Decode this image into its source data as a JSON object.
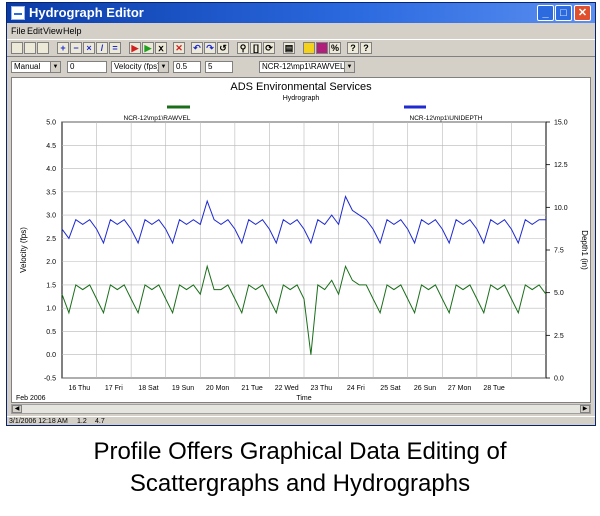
{
  "window": {
    "title": "Hydrograph Editor",
    "controls": {
      "minimize": "_",
      "maximize": "□",
      "close": "✕"
    }
  },
  "menu": {
    "items": [
      "File",
      "Edit",
      "View",
      "Help"
    ]
  },
  "toolbar": {
    "icons": [
      "new-icon",
      "save-icon",
      "print-icon",
      "add-point-icon",
      "delete-point-icon",
      "delete-range-icon",
      "draw-line-icon",
      "equalize-icon",
      "flag-icon",
      "flag-green-icon",
      "flag-edit-icon",
      "cancel-icon",
      "undo-icon",
      "redo-icon",
      "repeat-icon",
      "zoom-icon",
      "zoom-fit-icon",
      "refresh-icon",
      "properties-icon",
      "yellow-bar-icon",
      "color-icon",
      "percent-icon",
      "help-icon",
      "context-help-icon"
    ]
  },
  "params": {
    "mode": "Manual",
    "value1": "0",
    "entity": "Velocity (fps)",
    "value2": "0.5",
    "value3": "5",
    "series": "NCR-12\\mp1\\RAWVEL"
  },
  "status": {
    "datetime": "3/1/2006 12:18 AM",
    "v1": "1.2",
    "v2": "4.7"
  },
  "caption": {
    "line1": "Profile Offers Graphical Data Editing of",
    "line2": "Scattergraphs and Hydrographs"
  },
  "chart_data": {
    "type": "line",
    "title": "ADS Environmental Services",
    "subtitle": "Hydrograph",
    "xlabel": "Time",
    "ylabel": "Velocity (fps)",
    "y2label": "Depth1 (in)",
    "x_period_label": "Feb 2006",
    "x_ticks": [
      "16 Thu",
      "17 Fri",
      "18 Sat",
      "19 Sun",
      "20 Mon",
      "21 Tue",
      "22 Wed",
      "23 Thu",
      "24 Fri",
      "25 Sat",
      "26 Sun",
      "27 Mon",
      "28 Tue"
    ],
    "xlim_days": [
      15,
      29
    ],
    "ylim": [
      -0.5,
      5.0
    ],
    "y_ticks": [
      "5.0",
      "4.5",
      "4.0",
      "3.5",
      "3.0",
      "2.5",
      "2.0",
      "1.5",
      "1.0",
      "0.5",
      "0.0",
      "-0.5"
    ],
    "y2lim": [
      0,
      15
    ],
    "y2_ticks": [
      "15.0",
      "12.5",
      "10.0",
      "7.5",
      "5.0",
      "2.5",
      "0.0"
    ],
    "grid": true,
    "legend_placement": "top",
    "series": [
      {
        "name": "NCR-12\\mp1\\RAWVEL",
        "axis": "left",
        "color": "#1a6e1a",
        "x_days": [
          15.0,
          15.2,
          15.4,
          15.6,
          15.8,
          16.0,
          16.2,
          16.4,
          16.6,
          16.8,
          17.0,
          17.2,
          17.4,
          17.6,
          17.8,
          18.0,
          18.2,
          18.4,
          18.6,
          18.8,
          19.0,
          19.2,
          19.4,
          19.6,
          19.8,
          20.0,
          20.2,
          20.4,
          20.6,
          20.8,
          21.0,
          21.2,
          21.4,
          21.6,
          21.8,
          22.0,
          22.2,
          22.4,
          22.6,
          22.8,
          23.0,
          23.2,
          23.4,
          23.6,
          23.8,
          24.0,
          24.2,
          24.4,
          24.6,
          24.8,
          25.0,
          25.2,
          25.4,
          25.6,
          25.8,
          26.0,
          26.2,
          26.4,
          26.6,
          26.8,
          27.0,
          27.2,
          27.4,
          27.6,
          27.8,
          28.0,
          28.2,
          28.4,
          28.6,
          28.8,
          29.0
        ],
        "values": [
          1.3,
          0.9,
          1.5,
          1.4,
          1.5,
          1.2,
          0.9,
          1.5,
          1.4,
          1.5,
          1.2,
          0.9,
          1.5,
          1.4,
          1.5,
          1.2,
          0.9,
          1.5,
          1.4,
          1.5,
          1.3,
          1.9,
          1.4,
          1.4,
          1.5,
          1.2,
          0.9,
          1.5,
          1.4,
          1.5,
          1.2,
          0.9,
          1.5,
          1.4,
          1.5,
          1.2,
          0.0,
          1.5,
          1.4,
          1.6,
          1.3,
          1.9,
          1.6,
          1.5,
          1.5,
          1.2,
          0.9,
          1.5,
          1.4,
          1.5,
          1.2,
          0.9,
          1.5,
          1.4,
          1.5,
          1.2,
          0.9,
          1.5,
          1.4,
          1.5,
          1.2,
          0.9,
          1.5,
          1.4,
          1.5,
          1.2,
          0.9,
          1.5,
          1.4,
          1.5,
          1.3
        ]
      },
      {
        "name": "NCR-12\\mp1\\UNIDEPTH",
        "axis": "left",
        "color": "#1f2ad1",
        "x_days": [
          15.0,
          15.2,
          15.4,
          15.6,
          15.8,
          16.0,
          16.2,
          16.4,
          16.6,
          16.8,
          17.0,
          17.2,
          17.4,
          17.6,
          17.8,
          18.0,
          18.2,
          18.4,
          18.6,
          18.8,
          19.0,
          19.2,
          19.4,
          19.6,
          19.8,
          20.0,
          20.2,
          20.4,
          20.6,
          20.8,
          21.0,
          21.2,
          21.4,
          21.6,
          21.8,
          22.0,
          22.2,
          22.4,
          22.6,
          22.8,
          23.0,
          23.2,
          23.4,
          23.6,
          23.8,
          24.0,
          24.2,
          24.4,
          24.6,
          24.8,
          25.0,
          25.2,
          25.4,
          25.6,
          25.8,
          26.0,
          26.2,
          26.4,
          26.6,
          26.8,
          27.0,
          27.2,
          27.4,
          27.6,
          27.8,
          28.0,
          28.2,
          28.4,
          28.6,
          28.8,
          29.0
        ],
        "values": [
          2.7,
          2.5,
          2.9,
          2.8,
          2.9,
          2.7,
          2.4,
          2.9,
          2.8,
          2.9,
          2.7,
          2.4,
          2.9,
          2.8,
          2.9,
          2.7,
          2.4,
          2.9,
          2.8,
          2.9,
          2.8,
          3.3,
          2.9,
          2.8,
          2.9,
          2.7,
          2.4,
          2.9,
          2.8,
          2.9,
          2.7,
          2.4,
          2.9,
          2.8,
          2.9,
          2.7,
          2.4,
          2.9,
          2.8,
          3.0,
          2.8,
          3.4,
          3.1,
          3.0,
          2.9,
          2.7,
          2.4,
          2.9,
          2.8,
          2.9,
          2.7,
          2.4,
          2.9,
          2.8,
          2.9,
          2.7,
          2.4,
          2.9,
          2.8,
          2.9,
          2.7,
          2.4,
          2.9,
          2.8,
          2.9,
          2.7,
          2.4,
          2.9,
          2.8,
          2.9,
          2.9
        ]
      }
    ]
  }
}
